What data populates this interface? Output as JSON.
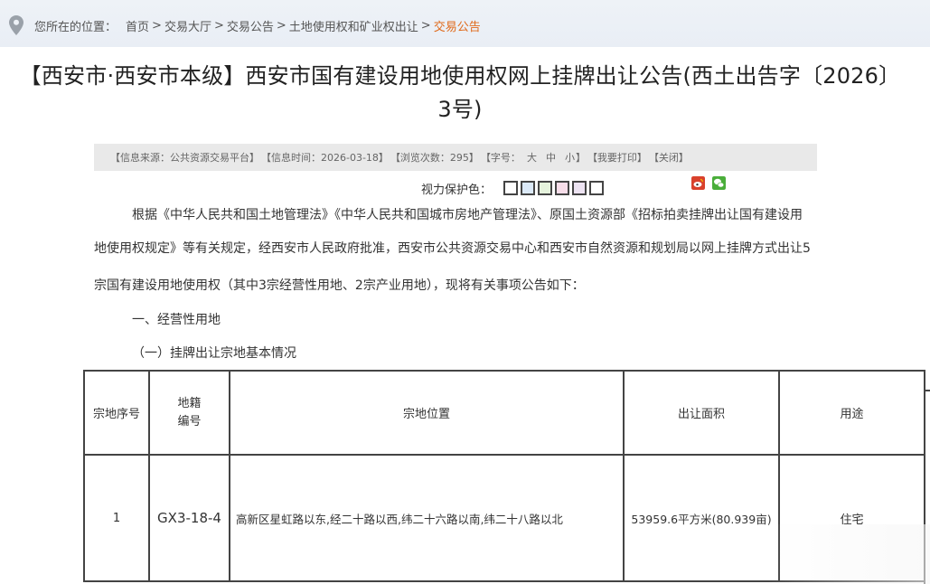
{
  "breadcrumb": {
    "prefix": "您所在的位置：",
    "items": [
      "首页",
      "交易大厅",
      "交易公告",
      "土地使用权和矿业权出让"
    ],
    "current": "交易公告",
    "separator": ">"
  },
  "title": "【西安市·西安市本级】西安市国有建设用地使用权网上挂牌出让公告(西土出告字〔2026〕3号)",
  "meta": {
    "source": "【信息来源：公共资源交易平台】",
    "time": "【信息时间：2026-03-18】",
    "views": "【浏览次数：295】",
    "font_label": "【字号：",
    "font_large": "大",
    "font_medium": "中",
    "font_small": "小",
    "font_close": "】",
    "print": "【我要打印】",
    "close": "【关闭】"
  },
  "eye_protection": {
    "label": "视力保护色：",
    "colors": [
      "#ffffff",
      "#dbe9f7",
      "#e5f2dc",
      "#f7dde9",
      "#ede3f2",
      "#ffffff"
    ]
  },
  "share": {
    "weibo_color": "#d9412c",
    "wechat_color": "#4aae3a"
  },
  "body": {
    "p1": "根据《中华人民共和国土地管理法》《中华人民共和国城市房地产管理法》、原国土资源部《招标拍卖挂牌出让国有建设用",
    "p2": "地使用权规定》等有关规定，经西安市人民政府批准，西安市公共资源交易中心和西安市自然资源和规划局以网上挂牌方式出让5",
    "p3": "宗国有建设用地使用权（其中3宗经营性用地、2宗产业用地），现将有关事项公告如下：",
    "section1": "一、经营性用地",
    "section1_1": "（一）挂牌出让宗地基本情况"
  },
  "table": {
    "headers": [
      "宗地序号",
      "地籍\n编号",
      "宗地位置",
      "出让面积",
      "用途"
    ],
    "rows": [
      [
        "1",
        "GX3-18-4",
        "高新区星虹路以东,经二十路以西,纬二十六路以南,纬二十八路以北",
        "53959.6平方米(80.939亩)",
        "住宅"
      ]
    ]
  }
}
